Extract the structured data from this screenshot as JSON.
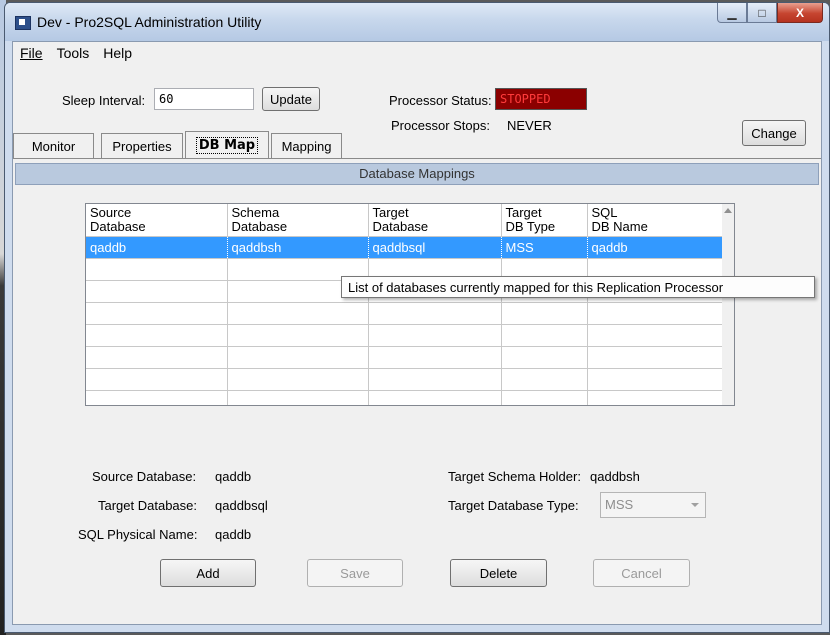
{
  "window": {
    "title": "Dev - Pro2SQL Administration Utility"
  },
  "titlebar_buttons": {
    "minimize": "▁",
    "maximize": "□",
    "close": "X"
  },
  "menu": [
    {
      "label": "File"
    },
    {
      "label": "Tools"
    },
    {
      "label": "Help"
    }
  ],
  "header": {
    "sleep_label": "Sleep Interval:",
    "sleep_value": "60",
    "update_button": "Update",
    "processor_status_label": "Processor Status:",
    "processor_status_value": "STOPPED",
    "processor_stops_label": "Processor Stops:",
    "processor_stops_value": "NEVER",
    "change_button": "Change"
  },
  "tabs": [
    {
      "label": "Monitor",
      "active": false
    },
    {
      "label": "Properties",
      "active": false
    },
    {
      "label": "DB Map",
      "active": true
    },
    {
      "label": "Mapping",
      "active": false
    }
  ],
  "panel": {
    "title": "Database Mappings"
  },
  "grid": {
    "columns": [
      {
        "line1": "Source",
        "line2": "Database"
      },
      {
        "line1": "Schema",
        "line2": "Database"
      },
      {
        "line1": "Target",
        "line2": "Database"
      },
      {
        "line1": "Target",
        "line2": "DB Type"
      },
      {
        "line1": "SQL",
        "line2": "DB Name"
      }
    ],
    "rows": [
      [
        "qaddb",
        "qaddbsh",
        "qaddbsql",
        "MSS",
        "qaddb"
      ]
    ],
    "empty_rows": 7
  },
  "tooltip": "List of databases currently mapped for this Replication Processor",
  "details": {
    "source_database_label": "Source Database:",
    "source_database_value": "qaddb",
    "target_database_label": "Target Database:",
    "target_database_value": "qaddbsql",
    "sql_physical_label": "SQL Physical Name:",
    "sql_physical_value": "qaddb",
    "target_schema_label": "Target Schema Holder:",
    "target_schema_value": "qaddbsh",
    "target_db_type_label": "Target Database Type:",
    "target_db_type_value": "MSS"
  },
  "actions": {
    "add": "Add",
    "save": "Save",
    "delete": "Delete",
    "cancel": "Cancel"
  }
}
